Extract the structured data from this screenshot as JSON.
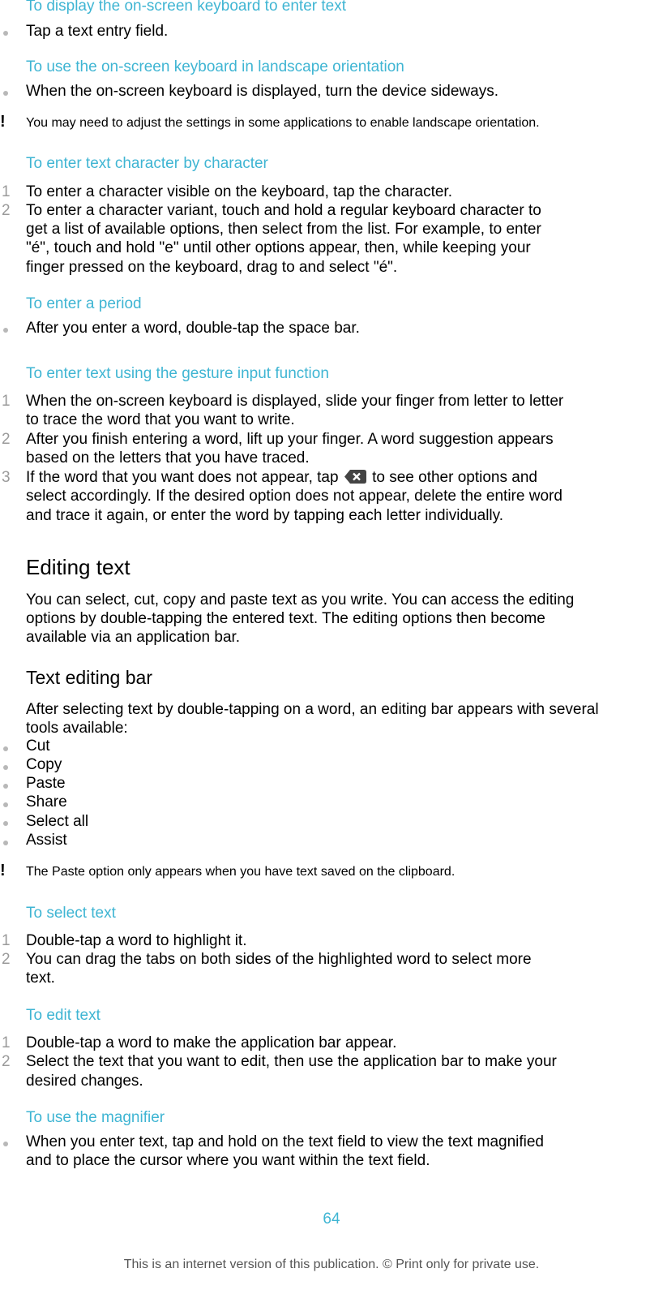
{
  "sections": {
    "display_keyboard": {
      "heading": "To display the on-screen keyboard to enter text",
      "bullets": [
        "Tap a text entry field."
      ]
    },
    "landscape": {
      "heading": "To use the on-screen keyboard in landscape orientation",
      "bullets": [
        "When the on-screen keyboard is displayed, turn the device sideways."
      ],
      "note": "You may need to adjust the settings in some applications to enable landscape orientation."
    },
    "char_by_char": {
      "heading": "To enter text character by character",
      "steps": [
        {
          "num": "1",
          "lines": [
            "To enter a character visible on the keyboard, tap the character."
          ]
        },
        {
          "num": "2",
          "lines": [
            "To enter a character variant, touch and hold a regular keyboard character to",
            "get a list of available options, then select from the list. For example, to enter",
            "\"é\", touch and hold \"e\" until other options appear, then, while keeping your",
            "finger pressed on the keyboard, drag to and select \"é\"."
          ]
        }
      ]
    },
    "period": {
      "heading": "To enter a period",
      "bullets": [
        "After you enter a word, double-tap the space bar."
      ]
    },
    "gesture": {
      "heading": "To enter text using the gesture input function",
      "steps": [
        {
          "num": "1",
          "lines": [
            "When the on-screen keyboard is displayed, slide your finger from letter to letter",
            "to trace the word that you want to write."
          ]
        },
        {
          "num": "2",
          "lines": [
            "After you finish entering a word, lift up your finger. A word suggestion appears",
            "based on the letters that you have traced."
          ]
        },
        {
          "num": "3",
          "line1_before": "If the word that you want does not appear, tap",
          "line1_after": "to see other options and",
          "lines_rest": [
            "select accordingly. If the desired option does not appear, delete the entire word",
            "and trace it again, or enter the word by tapping each letter individually."
          ],
          "icon": "backspace-icon"
        }
      ]
    },
    "editing_text": {
      "heading": "Editing text",
      "paragraph_lines": [
        "You can select, cut, copy and paste text as you write. You can access the editing",
        "options by double-tapping the entered text. The editing options then become",
        "available via an application bar."
      ]
    },
    "text_editing_bar": {
      "heading": "Text editing bar",
      "paragraph_lines": [
        "After selecting text by double-tapping on a word, an editing bar appears with several",
        "tools available:"
      ],
      "tools": [
        "Cut",
        "Copy",
        "Paste",
        "Share",
        "Select all",
        "Assist"
      ],
      "note_before": "The",
      "note_bold": "Paste",
      "note_after": "option only appears when you have text saved on the clipboard."
    },
    "select_text": {
      "heading": "To select text",
      "steps": [
        {
          "num": "1",
          "lines": [
            "Double-tap a word to highlight it."
          ]
        },
        {
          "num": "2",
          "lines": [
            "You can drag the tabs on both sides of the highlighted word to select more",
            "text."
          ]
        }
      ]
    },
    "edit_text": {
      "heading": "To edit text",
      "steps": [
        {
          "num": "1",
          "lines": [
            "Double-tap a word to make the application bar appear."
          ]
        },
        {
          "num": "2",
          "lines": [
            "Select the text that you want to edit, then use the application bar to make your",
            "desired changes."
          ]
        }
      ]
    },
    "magnifier": {
      "heading": "To use the magnifier",
      "bullets_lines": [
        "When you enter text, tap and hold on the text field to view the text magnified",
        "and to place the cursor where you want within the text field."
      ]
    }
  },
  "page_number": "64",
  "footer": "This is an internet version of this publication. © Print only for private use.",
  "colors": {
    "accent": "#3fb5d3",
    "marker": "#9a9a9a"
  }
}
